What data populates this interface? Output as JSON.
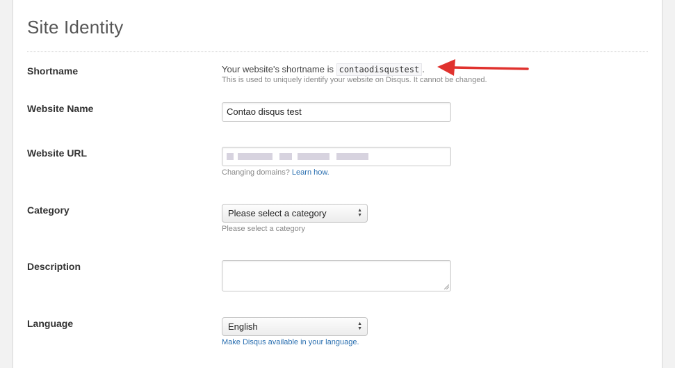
{
  "page": {
    "title": "Site Identity"
  },
  "shortname": {
    "label": "Shortname",
    "text_before": "Your website's shortname is",
    "value": "contaodisqustest",
    "text_after": ".",
    "help": "This is used to uniquely identify your website on Disqus. It cannot be changed."
  },
  "website_name": {
    "label": "Website Name",
    "value": "Contao disqus test"
  },
  "website_url": {
    "label": "Website URL",
    "help_text": "Changing domains?",
    "help_link": "Learn how."
  },
  "category": {
    "label": "Category",
    "selected": "Please select a category",
    "help": "Please select a category"
  },
  "description": {
    "label": "Description",
    "value": ""
  },
  "language": {
    "label": "Language",
    "selected": "English",
    "help_link": "Make Disqus available in your language."
  },
  "colors": {
    "link": "#2a6fb0",
    "annotation_arrow": "#e0322e"
  }
}
